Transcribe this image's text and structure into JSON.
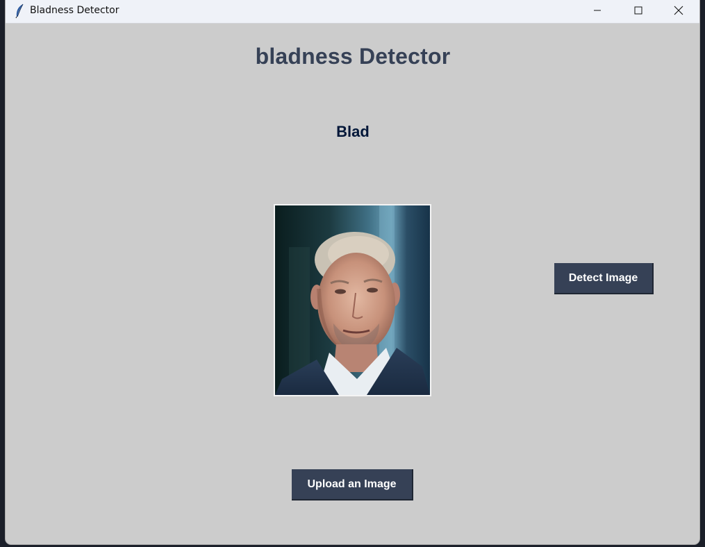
{
  "window": {
    "title": "Bladness Detector",
    "icon": "feather-icon",
    "controls": [
      "minimize-icon",
      "maximize-icon",
      "close-icon"
    ]
  },
  "main": {
    "heading": "bladness Detector",
    "result_label": "Blad",
    "detect_button_label": "Detect Image",
    "upload_button_label": "Upload an Image"
  },
  "colors": {
    "background": "#cccccc",
    "heading": "#364156",
    "result": "#011638",
    "button_bg": "#364156",
    "button_text": "#ffffff"
  }
}
